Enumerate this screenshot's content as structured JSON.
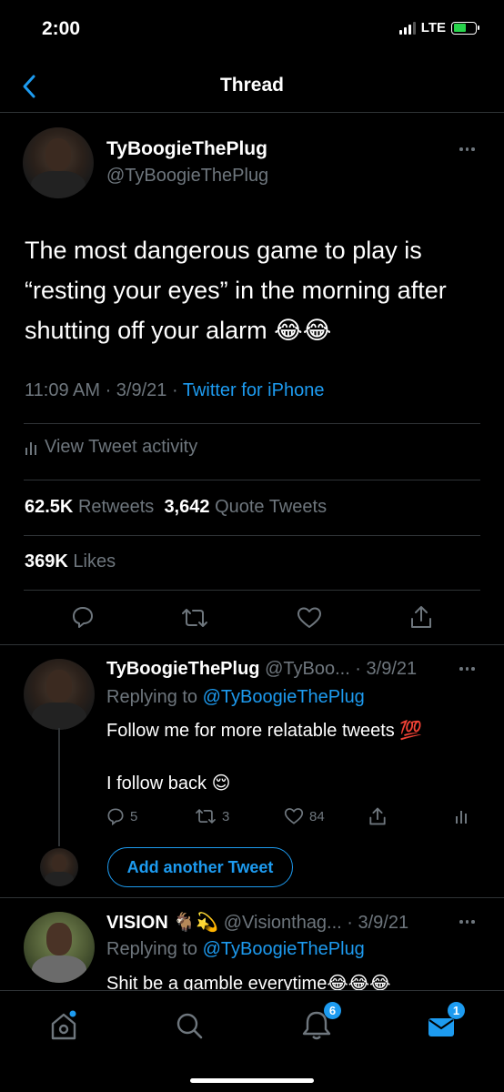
{
  "status": {
    "time": "2:00",
    "network": "LTE"
  },
  "nav": {
    "title": "Thread"
  },
  "main_tweet": {
    "name": "TyBoogieThePlug",
    "handle": "@TyBoogieThePlug",
    "text": "The most dangerous game to play is “resting your eyes” in the morning after shutting off your alarm 😂😂",
    "time": "11:09 AM · 3/9/21 · ",
    "source": "Twitter for iPhone",
    "activity_label": "View Tweet activity",
    "retweets_count": "62.5K",
    "retweets_label": "Retweets",
    "quotes_count": "3,642",
    "quotes_label": "Quote Tweets",
    "likes_count": "369K",
    "likes_label": "Likes"
  },
  "reply1": {
    "name": "TyBoogieThePlug",
    "handle_date": "@TyBoo... · 3/9/21",
    "replying_prefix": "Replying to ",
    "replying_to": "@TyBoogieThePlug",
    "line1": "Follow me for more relatable tweets 💯",
    "line2": "I follow back 😌",
    "reply_count": "5",
    "retweet_count": "3",
    "like_count": "84"
  },
  "add_tweet_label": "Add another Tweet",
  "reply2": {
    "name": "VISION 🐐💫",
    "handle_date": "@Visionthag... · 3/9/21",
    "replying_prefix": "Replying to ",
    "replying_to": "@TyBoogieThePlug",
    "line1": "Shit be a gamble everytime😂😂😂"
  },
  "tabbar": {
    "notifications_badge": "6",
    "messages_badge": "1"
  },
  "colors": {
    "accent": "#1d9bf0",
    "background": "#000000",
    "muted": "#6e767d",
    "divider": "#2f3336"
  }
}
